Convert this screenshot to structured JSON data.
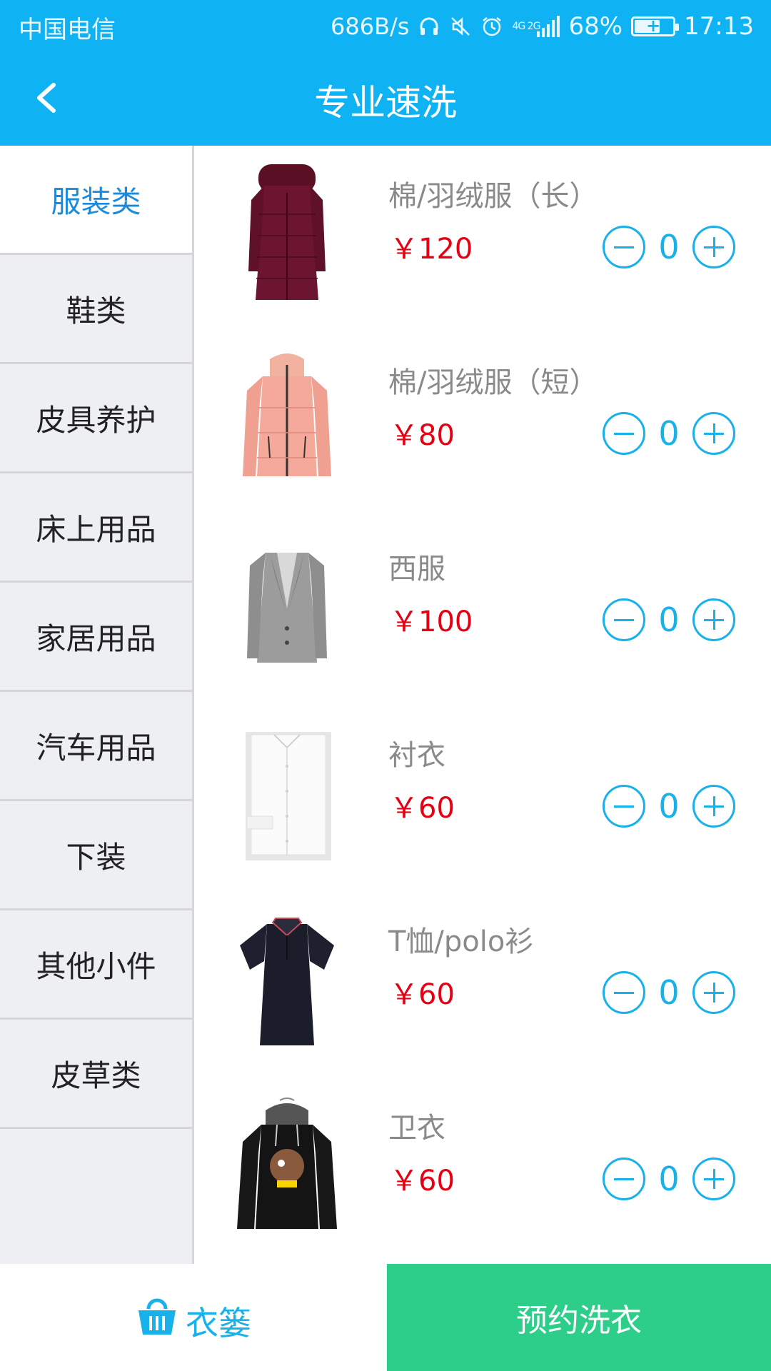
{
  "status_bar": {
    "carrier": "中国电信",
    "net_speed": "686B/s",
    "network": "4G 2G",
    "battery": "68%",
    "battery_level": 0.68,
    "time": "17:13"
  },
  "header": {
    "title": "专业速洗"
  },
  "colors": {
    "header_bg": "#0fb2f2",
    "accent": "#19b1ea",
    "price": "#e60012",
    "active_category": "#1a8bdc",
    "book_button": "#2dce89"
  },
  "categories": [
    {
      "label": "服装类",
      "active": true
    },
    {
      "label": "鞋类"
    },
    {
      "label": "皮具养护"
    },
    {
      "label": "床上用品"
    },
    {
      "label": "家居用品"
    },
    {
      "label": "汽车用品"
    },
    {
      "label": "下装"
    },
    {
      "label": "其他小件"
    },
    {
      "label": "皮草类"
    }
  ],
  "products": [
    {
      "name": "棉/羽绒服（长）",
      "price": "￥120",
      "qty": "0",
      "image": "long-down-coat"
    },
    {
      "name": "棉/羽绒服（短）",
      "price": "￥80",
      "qty": "0",
      "image": "short-down-jacket"
    },
    {
      "name": "西服",
      "price": "￥100",
      "qty": "0",
      "image": "suit-jacket"
    },
    {
      "name": "衬衣",
      "price": "￥60",
      "qty": "0",
      "image": "shirt"
    },
    {
      "name": "T恤/polo衫",
      "price": "￥60",
      "qty": "0",
      "image": "polo-shirt"
    },
    {
      "name": "卫衣",
      "price": "￥60",
      "qty": "0",
      "image": "hoodie"
    }
  ],
  "bottom": {
    "basket_label": "衣篓",
    "basket_icon": "basket-icon",
    "book_label": "预约洗衣"
  }
}
